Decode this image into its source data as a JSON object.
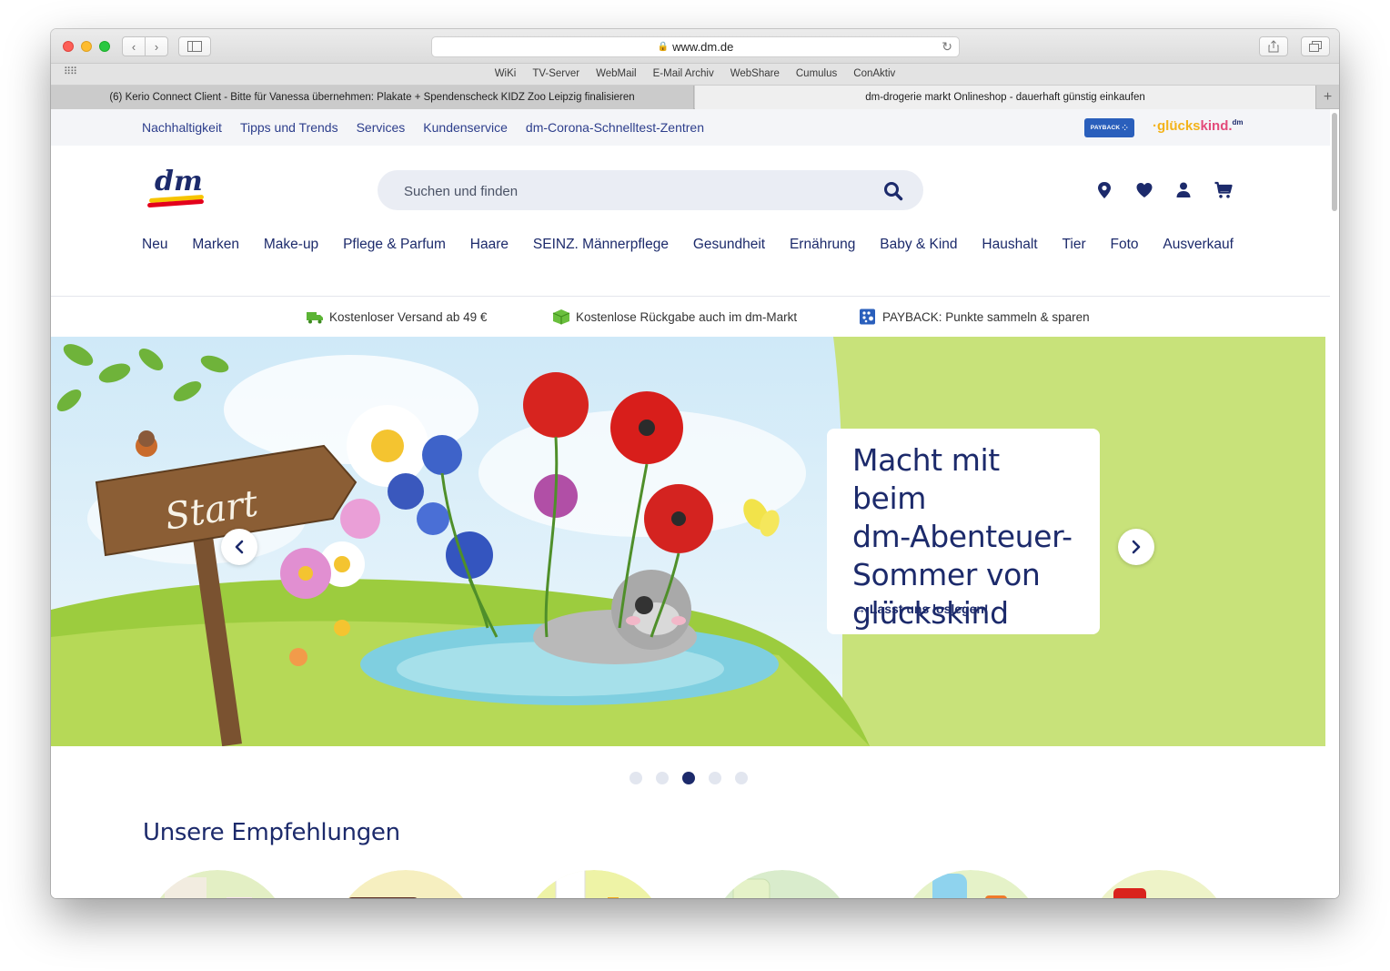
{
  "browser": {
    "url": "www.dm.de",
    "favorites": [
      "WiKi",
      "TV-Server",
      "WebMail",
      "E-Mail Archiv",
      "WebShare",
      "Cumulus",
      "ConAktiv"
    ],
    "tabs": [
      {
        "title": "(6) Kerio Connect Client - Bitte für Vanessa übernehmen: Plakate + Spendenscheck KIDZ Zoo Leipzig finalisieren",
        "active": false
      },
      {
        "title": "dm-drogerie markt Onlineshop - dauerhaft günstig einkaufen",
        "active": true
      }
    ]
  },
  "topbar": {
    "links": [
      "Nachhaltigkeit",
      "Tipps und Trends",
      "Services",
      "Kundenservice",
      "dm-Corona-Schnelltest-Zentren"
    ],
    "payback_logo": "PAYBACK",
    "glueckskind_logo": {
      "part1": "·glücks",
      "part2": "kind.",
      "badge": "dm"
    }
  },
  "header": {
    "logo": "dm",
    "search_placeholder": "Suchen und finden",
    "icons": [
      "location-pin-icon",
      "heart-icon",
      "user-icon",
      "cart-icon"
    ]
  },
  "categories": [
    "Neu",
    "Marken",
    "Make-up",
    "Pflege & Parfum",
    "Haare",
    "SEINZ. Männerpflege",
    "Gesundheit",
    "Ernährung",
    "Baby & Kind",
    "Haushalt",
    "Tier",
    "Foto",
    "Ausverkauf"
  ],
  "usps": [
    {
      "icon": "truck-icon",
      "text": "Kostenloser Versand ab 49 €"
    },
    {
      "icon": "box-icon",
      "text": "Kostenlose Rückgabe auch im dm-Markt"
    },
    {
      "icon": "payback-icon",
      "text": "PAYBACK: Punkte sammeln & sparen"
    }
  ],
  "hero": {
    "sign_text": "Start",
    "title_lines": [
      "Macht mit beim",
      "dm-Abenteuer-",
      "Sommer von",
      "glückskind"
    ],
    "cta": "→ Lasst uns loslegen!",
    "slides_total": 5,
    "active_slide": 3
  },
  "recommendations": {
    "title": "Unsere Empfehlungen",
    "bubble_colors": [
      "#e3efc4",
      "#f6efc0",
      "#eef3a6",
      "#d9eccc",
      "#e5f2c8",
      "#eef3c8"
    ]
  },
  "colors": {
    "brand_blue": "#1c2a6b",
    "brand_red": "#e3001b",
    "brand_yellow": "#f7c400"
  }
}
